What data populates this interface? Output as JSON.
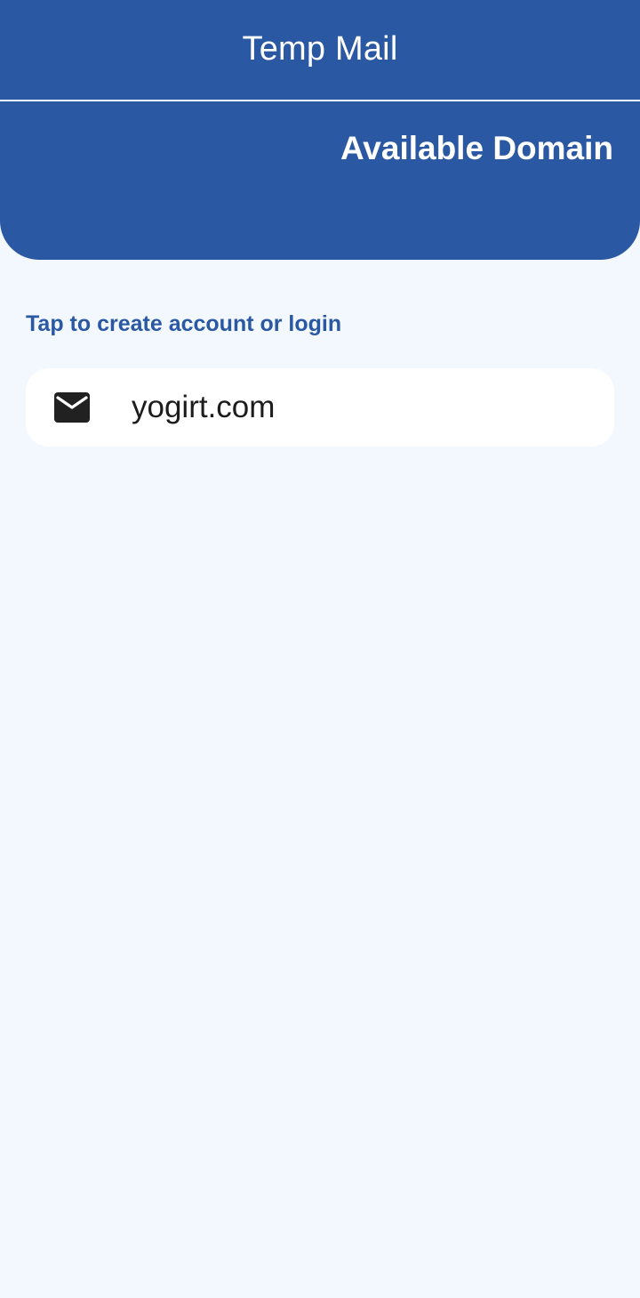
{
  "app_bar": {
    "title": "Temp Mail"
  },
  "header": {
    "title": "Available Domain"
  },
  "hint": {
    "text": "Tap to create account or login"
  },
  "domains": [
    {
      "name": "yogirt.com",
      "icon": "mail-icon"
    }
  ],
  "colors": {
    "primary": "#2A58A2",
    "background": "#F3F8FE",
    "card": "#FFFFFF",
    "text_dark": "#1C1C1C"
  }
}
